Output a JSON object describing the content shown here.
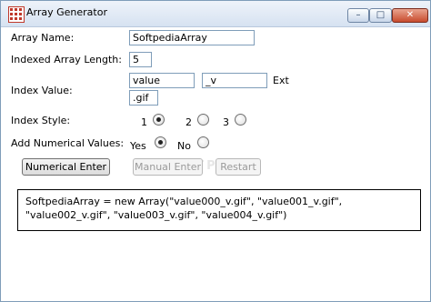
{
  "window": {
    "title": "Array Generator",
    "controls": {
      "minimize": "–",
      "maximize": "□",
      "close": "✕"
    }
  },
  "form": {
    "array_name_label": "Array Name:",
    "array_name_value": "SoftpediaArray",
    "indexed_length_label": "Indexed Array Length:",
    "indexed_length_value": "5",
    "index_value_label": "Index Value:",
    "index_value_prefix": "value",
    "index_value_suffix": "_v",
    "ext_label": "Ext",
    "ext_value": ".gif",
    "index_style_label": "Index Style:",
    "index_style_options": [
      {
        "label": "1",
        "selected": true
      },
      {
        "label": "2",
        "selected": false
      },
      {
        "label": "3",
        "selected": false
      }
    ],
    "add_numerical_label": "Add Numerical Values:",
    "add_numerical_options": [
      {
        "label": "Yes",
        "selected": true
      },
      {
        "label": "No",
        "selected": false
      }
    ]
  },
  "buttons": {
    "numerical_enter": "Numerical Enter",
    "manual_enter": "Manual Enter",
    "restart": "Restart"
  },
  "output": {
    "line1": "SoftpediaArray = new Array(\"value000_v.gif\", \"value001_v.gif\",",
    "line2": "\"value002_v.gif\", \"value003_v.gif\", \"value004_v.gif\")"
  }
}
